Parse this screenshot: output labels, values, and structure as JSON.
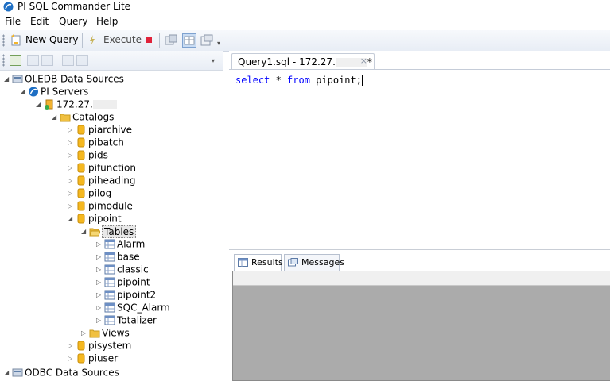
{
  "window": {
    "title": "PI SQL Commander Lite"
  },
  "menu": [
    "File",
    "Edit",
    "Query",
    "Help"
  ],
  "toolbar": {
    "new_query": "New Query",
    "execute": "Execute"
  },
  "tree": {
    "oledb": "OLEDB Data Sources",
    "pi_servers": "PI Servers",
    "server": "172.27.",
    "catalogs": "Catalogs",
    "catalog_items": [
      "piarchive",
      "pibatch",
      "pids",
      "pifunction",
      "piheading",
      "pilog",
      "pimodule"
    ],
    "pipoint": "pipoint",
    "tables": "Tables",
    "table_items": [
      "Alarm",
      "base",
      "classic",
      "pipoint",
      "pipoint2",
      "SQC_Alarm",
      "Totalizer"
    ],
    "views": "Views",
    "after_items": [
      "pisystem",
      "piuser"
    ],
    "odbc": "ODBC Data Sources"
  },
  "editor": {
    "tab_title": "Query1.sql - 172.27.",
    "tab_suffix": "*",
    "tab_close": "×",
    "code": {
      "kw1": "select",
      "mid1": " * ",
      "kw2": "from",
      "rest": " pipoint;"
    }
  },
  "results": {
    "tab_results": "Results",
    "tab_messages": "Messages"
  },
  "colors": {
    "accent": "#0000ff",
    "folder": "#f0c040",
    "db": "#f5b820"
  }
}
